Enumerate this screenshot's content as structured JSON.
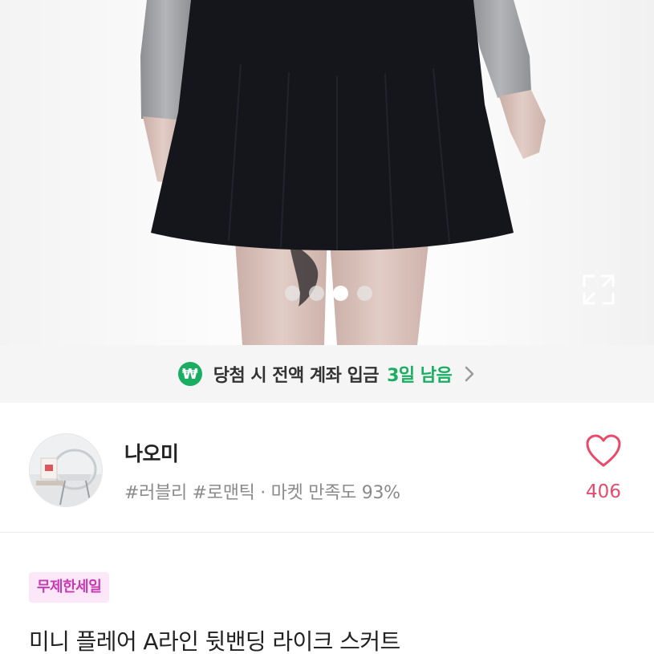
{
  "gallery": {
    "slide_count": 4,
    "active_index": 2,
    "expand_icon": "expand-icon"
  },
  "banner": {
    "icon": "won-icon",
    "icon_glyph": "₩",
    "text": "당첨 시 전액 계좌 입금",
    "days_left": "3일 남음",
    "accent_color": "#1aae62"
  },
  "seller": {
    "name": "나오미",
    "meta": "#러블리 #로맨틱 · 마켓 만족도 93%",
    "likes": "406",
    "like_color": "#e94a6b"
  },
  "product": {
    "tag": "무제한세일",
    "title": "미니 플레어  A라인 뒷밴딩 라이크 스커트"
  }
}
